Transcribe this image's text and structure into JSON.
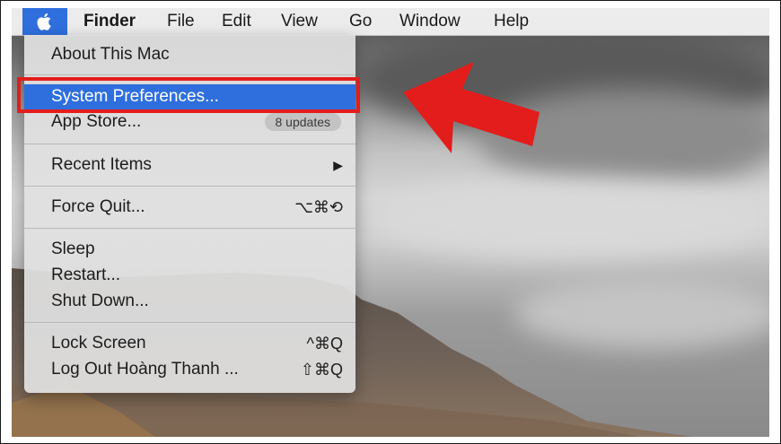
{
  "menubar": {
    "apple_icon": "apple-logo",
    "items": [
      "Finder",
      "File",
      "Edit",
      "View",
      "Go",
      "Window",
      "Help"
    ]
  },
  "apple_menu": {
    "about": "About This Mac",
    "system_preferences": "System Preferences...",
    "app_store": "App Store...",
    "app_store_badge": "8 updates",
    "recent_items": "Recent Items",
    "recent_items_arrow": "▶",
    "force_quit": "Force Quit...",
    "force_quit_shortcut": "⌥⌘⟲",
    "sleep": "Sleep",
    "restart": "Restart...",
    "shut_down": "Shut Down...",
    "lock_screen": "Lock Screen",
    "lock_screen_shortcut": "^⌘Q",
    "log_out": "Log Out Hoàng Thanh ...",
    "log_out_shortcut": "⇧⌘Q"
  },
  "annotation": {
    "highlight_color": "#e31c1c",
    "arrow_color": "#e31c1c",
    "selected_color": "#2f6fdd"
  }
}
